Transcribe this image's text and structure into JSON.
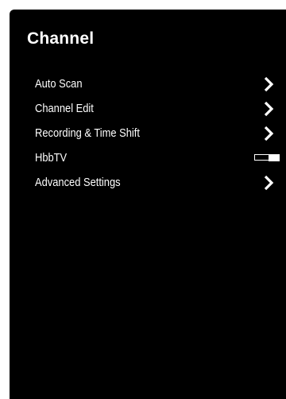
{
  "panel": {
    "title": "Channel"
  },
  "menu": {
    "items": [
      {
        "label": "Auto Scan",
        "control": "chevron-right-icon"
      },
      {
        "label": "Channel Edit",
        "control": "chevron-right-icon"
      },
      {
        "label": "Recording & Time Shift",
        "control": "chevron-right-icon"
      },
      {
        "label": "HbbTV",
        "control": "toggle-switch",
        "toggle_state": "off"
      },
      {
        "label": "Advanced Settings",
        "control": "chevron-right-icon"
      }
    ]
  },
  "colors": {
    "panel_background": "#000000",
    "text": "#ffffff",
    "page_background": "#ffffff"
  }
}
